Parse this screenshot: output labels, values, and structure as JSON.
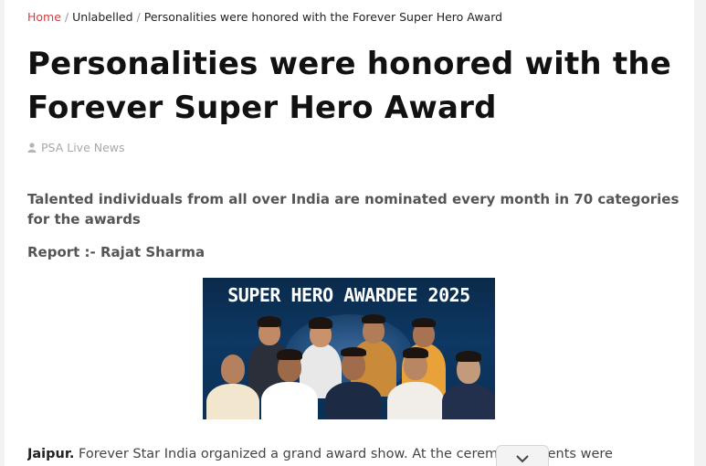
{
  "breadcrumb": {
    "home": "Home",
    "separator": "/",
    "category": "Unlabelled",
    "current": "Personalities were honored with the Forever Super Hero Award"
  },
  "article": {
    "title": "Personalities were honored with the Forever Super Hero Award",
    "author": "PSA Live News",
    "author_icon": "user-icon",
    "lead": "Talented individuals from all over India are nominated every month in 70 categories for the awards",
    "report": "Report :- Rajat Sharma",
    "banner_title": "SUPER HERO AWARDEE 2025",
    "body_city": "Jaipur.",
    "body_text": " Forever Star India organized a grand award show. At the ceremony, talents were"
  },
  "scroll_button": {
    "icon": "chevron-down-icon"
  },
  "colors": {
    "home_link": "#d33d3d",
    "title": "#111111",
    "muted": "#a8a8a8",
    "banner_bg": "#0d3863"
  }
}
